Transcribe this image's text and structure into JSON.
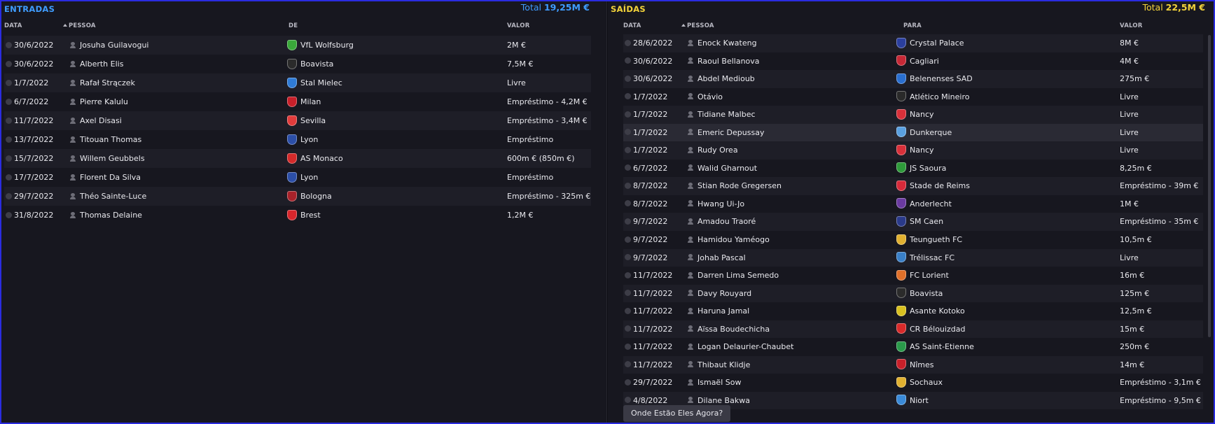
{
  "entradas": {
    "title": "ENTRADAS",
    "total_label": "Total",
    "total_value": "19,25M €",
    "columns": {
      "data": "DATA",
      "pessoa": "PESSOA",
      "de": "DE",
      "valor": "VALOR"
    },
    "rows": [
      {
        "date": "30/6/2022",
        "person": "Josuha Guilavogui",
        "club": "VfL Wolfsburg",
        "value": "2M €",
        "crest": "#3aa83a"
      },
      {
        "date": "30/6/2022",
        "person": "Alberth Elis",
        "club": "Boavista",
        "value": "7,5M €",
        "crest": "#2b2b2b"
      },
      {
        "date": "1/7/2022",
        "person": "Rafał Strączek",
        "club": "Stal Mielec",
        "value": "Livre",
        "crest": "#2f7bd6"
      },
      {
        "date": "6/7/2022",
        "person": "Pierre Kalulu",
        "club": "Milan",
        "value": "Empréstimo - 4,2M €",
        "crest": "#c8202a"
      },
      {
        "date": "11/7/2022",
        "person": "Axel Disasi",
        "club": "Sevilla",
        "value": "Empréstimo - 3,4M €",
        "crest": "#e23c3c"
      },
      {
        "date": "13/7/2022",
        "person": "Titouan Thomas",
        "club": "Lyon",
        "value": "Empréstimo",
        "crest": "#2c4fa8"
      },
      {
        "date": "15/7/2022",
        "person": "Willem Geubbels",
        "club": "AS Monaco",
        "value": "600m € (850m €)",
        "crest": "#d42a2a"
      },
      {
        "date": "17/7/2022",
        "person": "Florent Da Silva",
        "club": "Lyon",
        "value": "Empréstimo",
        "crest": "#2c4fa8"
      },
      {
        "date": "29/7/2022",
        "person": "Théo Sainte-Luce",
        "club": "Bologna",
        "value": "Empréstimo - 325m €",
        "crest": "#a8222a"
      },
      {
        "date": "31/8/2022",
        "person": "Thomas Delaine",
        "club": "Brest",
        "value": "1,2M €",
        "crest": "#d8262c"
      }
    ]
  },
  "saidas": {
    "title": "SAÍDAS",
    "total_label": "Total",
    "total_value": "22,5M €",
    "columns": {
      "data": "DATA",
      "pessoa": "PESSOA",
      "para": "PARA",
      "valor": "VALOR"
    },
    "rows": [
      {
        "date": "28/6/2022",
        "person": "Enock Kwateng",
        "club": "Crystal Palace",
        "value": "8M €",
        "crest": "#2b3f9e"
      },
      {
        "date": "30/6/2022",
        "person": "Raoul Bellanova",
        "club": "Cagliari",
        "value": "4M €",
        "crest": "#c62836"
      },
      {
        "date": "30/6/2022",
        "person": "Abdel Medioub",
        "club": "Belenenses SAD",
        "value": "275m €",
        "crest": "#2a6fd0"
      },
      {
        "date": "1/7/2022",
        "person": "Otávio",
        "club": "Atlético Mineiro",
        "value": "Livre",
        "crest": "#2a2a2a"
      },
      {
        "date": "1/7/2022",
        "person": "Tidiane Malbec",
        "club": "Nancy",
        "value": "Livre",
        "crest": "#d8303a"
      },
      {
        "date": "1/7/2022",
        "person": "Emeric Depussay",
        "club": "Dunkerque",
        "value": "Livre",
        "crest": "#5aa0e0"
      },
      {
        "date": "1/7/2022",
        "person": "Rudy Orea",
        "club": "Nancy",
        "value": "Livre",
        "crest": "#d8303a"
      },
      {
        "date": "6/7/2022",
        "person": "Walid Gharnout",
        "club": "JS Saoura",
        "value": "8,25m €",
        "crest": "#2e9a3a"
      },
      {
        "date": "8/7/2022",
        "person": "Stian Rode Gregersen",
        "club": "Stade de Reims",
        "value": "Empréstimo - 39m €",
        "crest": "#d62a3a"
      },
      {
        "date": "8/7/2022",
        "person": "Hwang Ui-Jo",
        "club": "Anderlecht",
        "value": "1M €",
        "crest": "#6a3aa0"
      },
      {
        "date": "9/7/2022",
        "person": "Amadou Traoré",
        "club": "SM Caen",
        "value": "Empréstimo - 35m €",
        "crest": "#2a3a8a"
      },
      {
        "date": "9/7/2022",
        "person": "Hamidou Yaméogo",
        "club": "Teungueth FC",
        "value": "10,5m €",
        "crest": "#e0b030"
      },
      {
        "date": "9/7/2022",
        "person": "Johab Pascal",
        "club": "Trélissac FC",
        "value": "Livre",
        "crest": "#3a80c8"
      },
      {
        "date": "11/7/2022",
        "person": "Darren Lima Semedo",
        "club": "FC Lorient",
        "value": "16m €",
        "crest": "#e0702a"
      },
      {
        "date": "11/7/2022",
        "person": "Davy Rouyard",
        "club": "Boavista",
        "value": "125m €",
        "crest": "#2b2b2b"
      },
      {
        "date": "11/7/2022",
        "person": "Haruna Jamal",
        "club": "Asante Kotoko",
        "value": "12,5m €",
        "crest": "#d8c020"
      },
      {
        "date": "11/7/2022",
        "person": "Aïssa Boudechicha",
        "club": "CR Bélouizdad",
        "value": "15m €",
        "crest": "#d82a2a"
      },
      {
        "date": "11/7/2022",
        "person": "Logan Delaurier-Chaubet",
        "club": "AS Saint-Etienne",
        "value": "250m €",
        "crest": "#2a9a4a"
      },
      {
        "date": "11/7/2022",
        "person": "Thibaut Klidje",
        "club": "Nîmes",
        "value": "14m €",
        "crest": "#c8202a"
      },
      {
        "date": "29/7/2022",
        "person": "Ismaël Sow",
        "club": "Sochaux",
        "value": "Empréstimo - 3,1m €",
        "crest": "#e0b030"
      },
      {
        "date": "4/8/2022",
        "person": "Dilane Bakwa",
        "club": "Niort",
        "value": "Empréstimo - 9,5m €",
        "crest": "#3a8ad8"
      }
    ]
  },
  "footer": {
    "where_now_button": "Onde Estão Eles Agora?"
  }
}
